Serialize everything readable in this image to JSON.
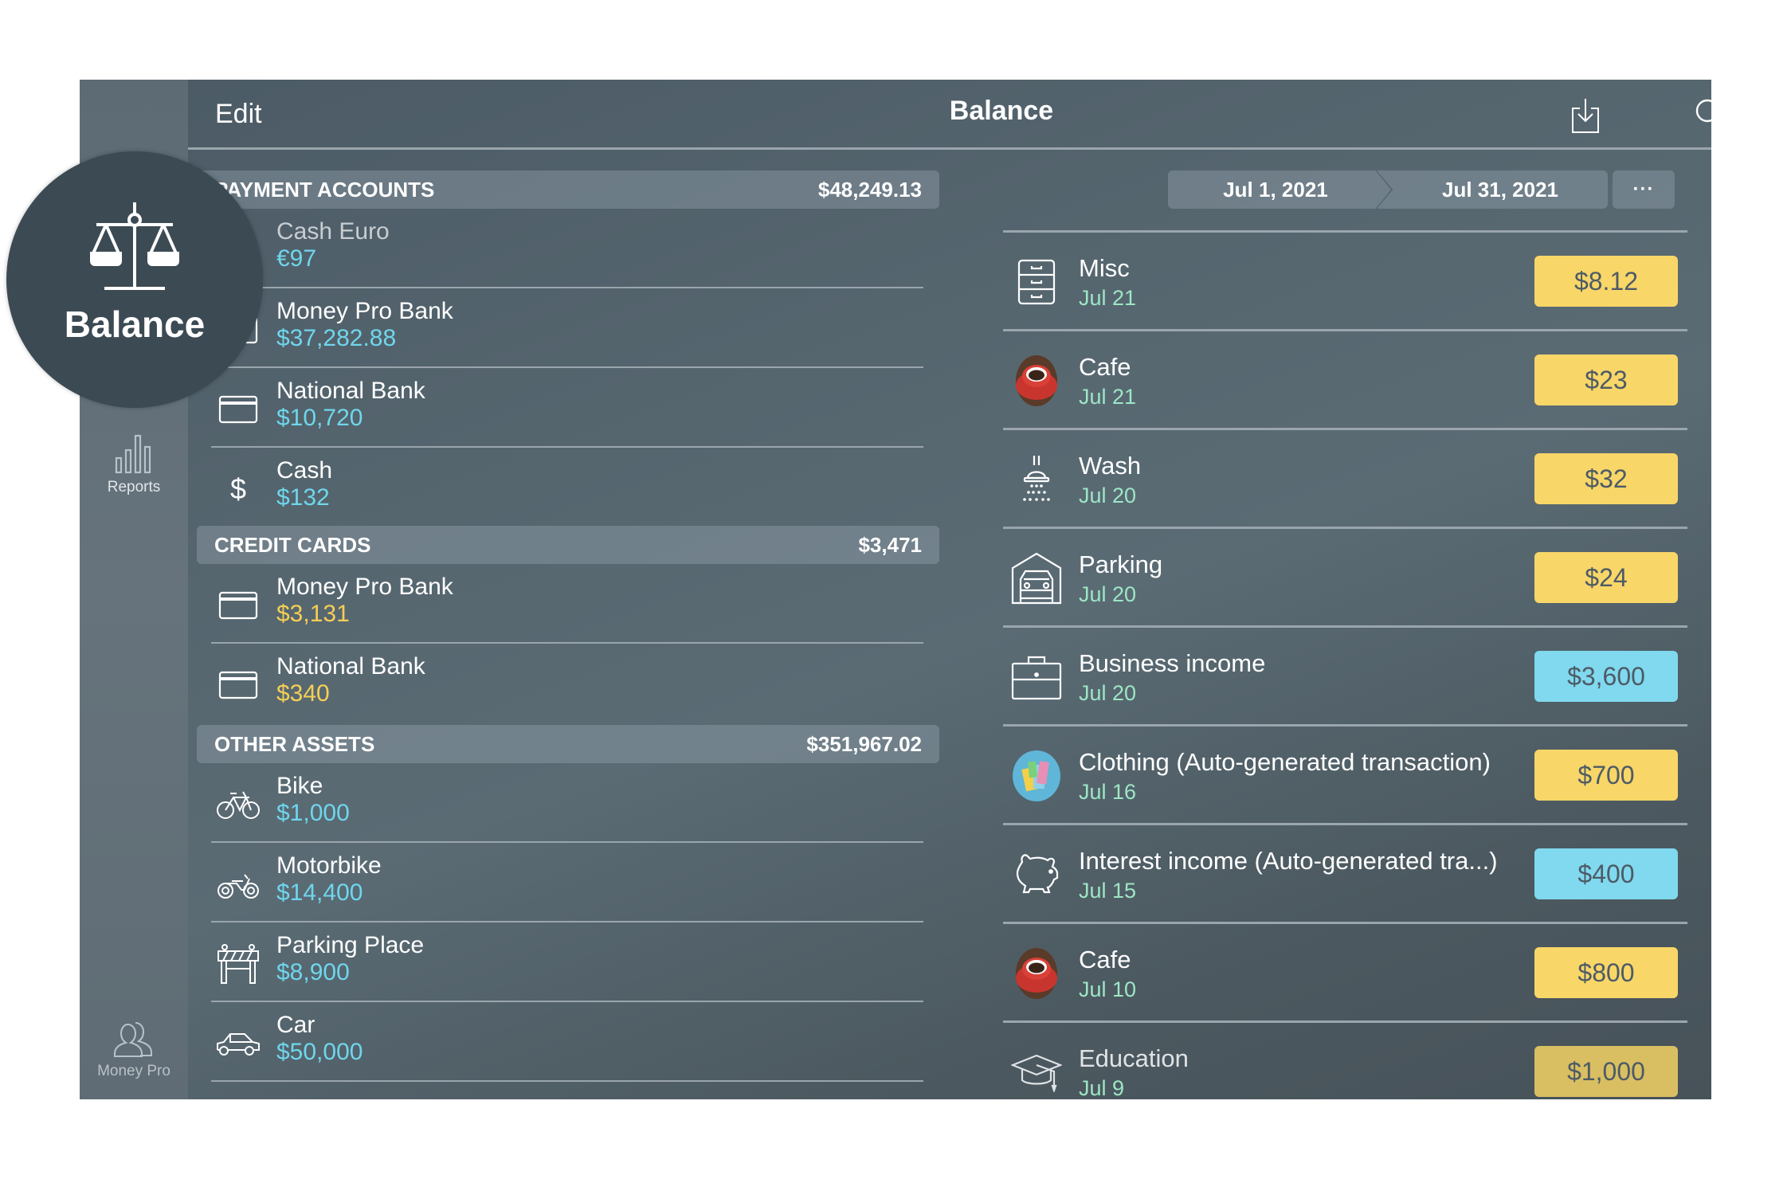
{
  "app": {
    "title": "Balance",
    "edit_label": "Edit",
    "icons": {
      "import": "import-icon",
      "search": "search-icon",
      "add": "plus-icon"
    }
  },
  "sidebar": {
    "active": {
      "label": "Balance",
      "icon": "scales-icon"
    },
    "items": [
      {
        "label": "Reports",
        "icon": "bar-chart-icon"
      },
      {
        "label": "Money Pro",
        "icon": "users-icon"
      }
    ]
  },
  "colors": {
    "positive_amount": "#6fd6ec",
    "negative_amount": "#f5cf55",
    "expense_badge": "#f8d668",
    "income_badge": "#80d9ee",
    "date_text": "#9de6c5"
  },
  "accounts": {
    "sections": [
      {
        "title": "PAYMENT ACCOUNTS",
        "total": "$48,249.13",
        "items": [
          {
            "name": "Cash Euro",
            "amount": "€97",
            "icon": "coins-icon",
            "type": "positive"
          },
          {
            "name": "Money Pro Bank",
            "amount": "$37,282.88",
            "icon": "wallet-icon",
            "type": "positive"
          },
          {
            "name": "National Bank",
            "amount": "$10,720",
            "icon": "card-icon",
            "type": "positive"
          },
          {
            "name": "Cash",
            "amount": "$132",
            "icon": "dollar-icon",
            "type": "positive"
          }
        ]
      },
      {
        "title": "CREDIT CARDS",
        "total": "$3,471",
        "items": [
          {
            "name": "Money Pro Bank",
            "amount": "$3,131",
            "icon": "card-icon",
            "type": "negative"
          },
          {
            "name": "National Bank",
            "amount": "$340",
            "icon": "card-icon",
            "type": "negative"
          }
        ]
      },
      {
        "title": "OTHER ASSETS",
        "total": "$351,967.02",
        "items": [
          {
            "name": "Bike",
            "amount": "$1,000",
            "icon": "bicycle-icon",
            "type": "positive"
          },
          {
            "name": "Motorbike",
            "amount": "$14,400",
            "icon": "motorbike-icon",
            "type": "positive"
          },
          {
            "name": "Parking Place",
            "amount": "$8,900",
            "icon": "barrier-icon",
            "type": "positive"
          },
          {
            "name": "Car",
            "amount": "$50,000",
            "icon": "car-icon",
            "type": "positive"
          }
        ]
      }
    ]
  },
  "period": {
    "from": "Jul 1, 2021",
    "to": "Jul 31, 2021",
    "more_label": "···"
  },
  "transactions": [
    {
      "name": "Misc",
      "date": "Jul 21",
      "amount": "$8.12",
      "kind": "expense",
      "icon": "drawers-icon"
    },
    {
      "name": "Cafe",
      "date": "Jul 21",
      "amount": "$23",
      "kind": "expense",
      "icon": "coffee-cup-icon"
    },
    {
      "name": "Wash",
      "date": "Jul 20",
      "amount": "$32",
      "kind": "expense",
      "icon": "shower-icon"
    },
    {
      "name": "Parking",
      "date": "Jul 20",
      "amount": "$24",
      "kind": "expense",
      "icon": "garage-icon"
    },
    {
      "name": "Business income",
      "date": "Jul 20",
      "amount": "$3,600",
      "kind": "income",
      "icon": "briefcase-icon"
    },
    {
      "name": "Clothing (Auto-generated transaction)",
      "date": "Jul 16",
      "amount": "$700",
      "kind": "expense",
      "icon": "shopping-bags-icon"
    },
    {
      "name": "Interest income (Auto-generated tra...)",
      "date": "Jul 15",
      "amount": "$400",
      "kind": "income",
      "icon": "piggy-bank-icon"
    },
    {
      "name": "Cafe",
      "date": "Jul 10",
      "amount": "$800",
      "kind": "expense",
      "icon": "coffee-cup-icon"
    },
    {
      "name": "Education",
      "date": "Jul 9",
      "amount": "$1,000",
      "kind": "expense",
      "icon": "graduation-cap-icon"
    }
  ]
}
